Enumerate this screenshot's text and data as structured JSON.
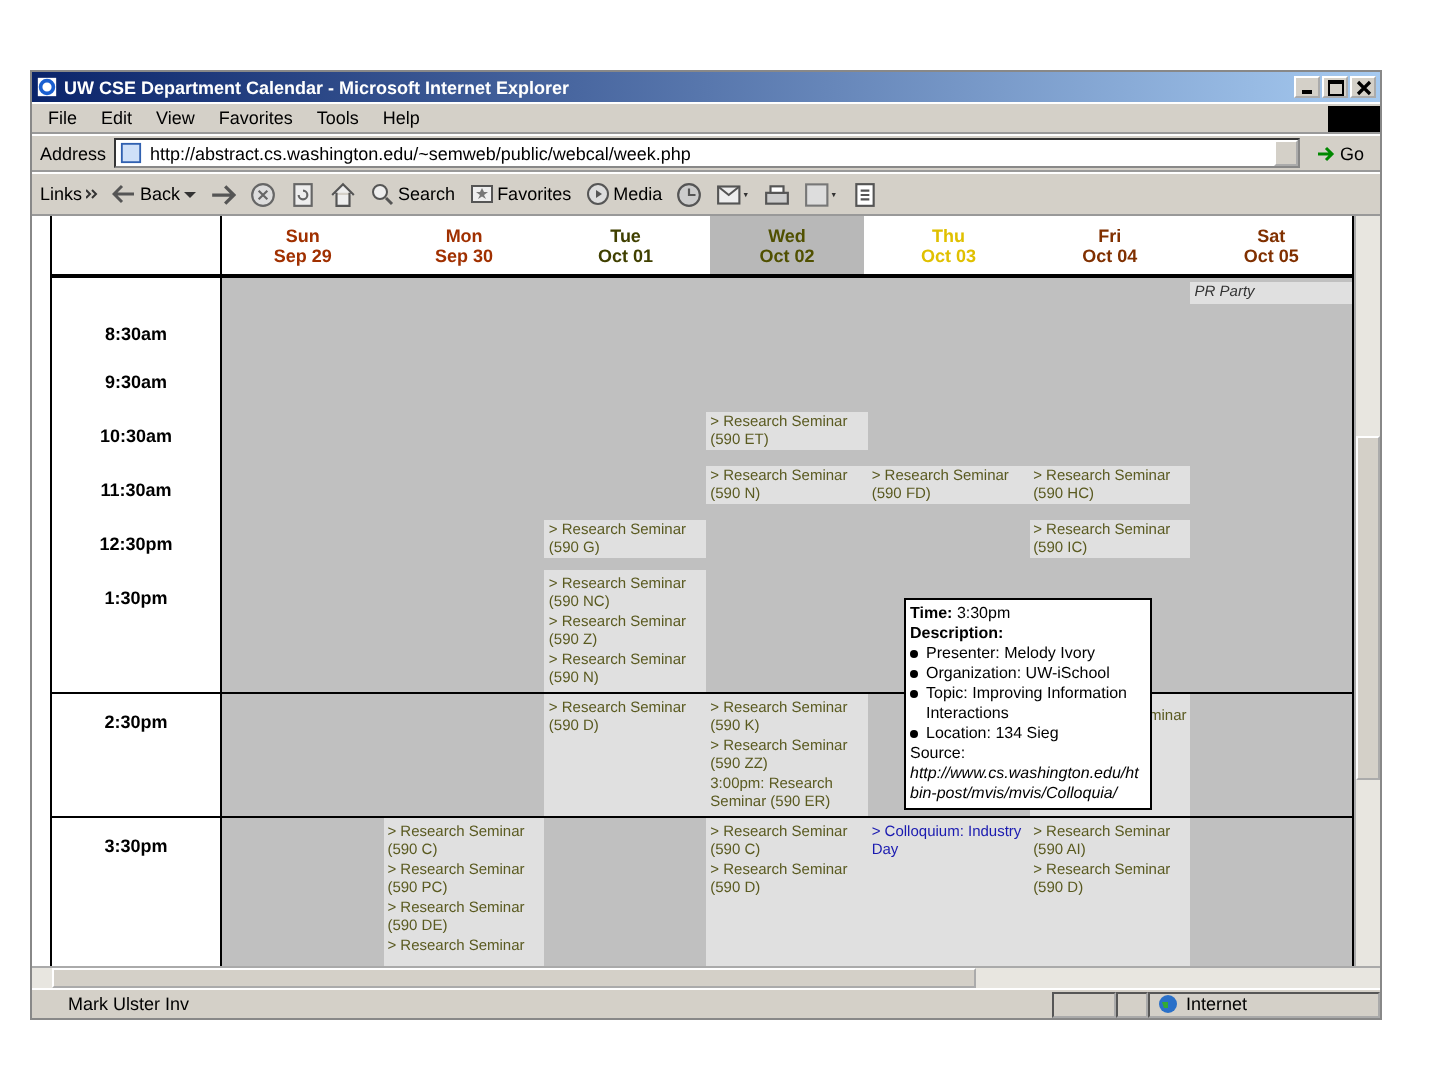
{
  "window": {
    "title": "UW CSE Department Calendar - Microsoft Internet Explorer"
  },
  "menu": [
    "File",
    "Edit",
    "View",
    "Favorites",
    "Tools",
    "Help"
  ],
  "address": {
    "label": "Address",
    "value": "http://abstract.cs.washington.edu/~semweb/public/webcal/week.php",
    "go": "Go"
  },
  "toolbar": {
    "links": "Links",
    "back": "Back",
    "search": "Search",
    "favorites": "Favorites",
    "media": "Media"
  },
  "calendar": {
    "days": [
      {
        "weekday": "Sun",
        "date": "Sep 29",
        "color": "#a03000",
        "selected": false
      },
      {
        "weekday": "Mon",
        "date": "Sep 30",
        "color": "#a03000",
        "selected": false
      },
      {
        "weekday": "Tue",
        "date": "Oct 01",
        "color": "#404000",
        "selected": false
      },
      {
        "weekday": "Wed",
        "date": "Oct 02",
        "color": "#505000",
        "selected": true
      },
      {
        "weekday": "Thu",
        "date": "Oct 03",
        "color": "#e0c000",
        "selected": false
      },
      {
        "weekday": "Fri",
        "date": "Oct 04",
        "color": "#803000",
        "selected": false
      },
      {
        "weekday": "Sat",
        "date": "Oct 05",
        "color": "#803000",
        "selected": false
      }
    ],
    "rows": [
      {
        "time": "8:30am",
        "cells": [
          [],
          [],
          [],
          [],
          [],
          [],
          [
            {
              "kind": "note",
              "text": "PR Party"
            }
          ]
        ]
      },
      {
        "time": "9:30am",
        "cells": [
          [],
          [],
          [],
          [],
          [],
          [],
          []
        ]
      },
      {
        "time": "10:30am",
        "cells": [
          [],
          [],
          [],
          [
            {
              "kind": "seminar",
              "text": "> Research Seminar (590 ET)"
            }
          ],
          [],
          [],
          []
        ]
      },
      {
        "time": "11:30am",
        "cells": [
          [],
          [],
          [],
          [
            {
              "kind": "seminar",
              "text": "> Research Seminar (590 N)"
            }
          ],
          [
            {
              "kind": "seminar",
              "text": "> Research Seminar (590 FD)"
            }
          ],
          [
            {
              "kind": "seminar",
              "text": "> Research Seminar (590 HC)"
            }
          ],
          []
        ]
      },
      {
        "time": "12:30pm",
        "cells": [
          [],
          [],
          [
            {
              "kind": "seminar",
              "text": "> Research Seminar (590 G)"
            }
          ],
          [],
          [],
          [
            {
              "kind": "seminar",
              "text": "> Research Seminar (590 IC)"
            }
          ],
          []
        ]
      },
      {
        "time": "1:30pm",
        "cells": [
          [],
          [],
          [
            {
              "kind": "seminar",
              "text": "> Research Seminar (590 NC)"
            },
            {
              "kind": "seminar",
              "text": "> Research Seminar (590 Z)"
            },
            {
              "kind": "seminar",
              "text": "> Research Seminar (590 N)"
            }
          ],
          [],
          [],
          [],
          []
        ]
      },
      {
        "time": "2:30pm",
        "cells": [
          [],
          [],
          [
            {
              "kind": "seminar",
              "text": "> Research Seminar (590 D)"
            }
          ],
          [
            {
              "kind": "seminar",
              "text": "> Research Seminar (590 K)"
            },
            {
              "kind": "seminar",
              "text": "> Research Seminar (590 ZZ)"
            },
            {
              "kind": "seminar",
              "text": "3:00pm: Research Seminar (590 ER)"
            }
          ],
          [],
          [
            {
              "kind": "fragment",
              "text": "minar"
            }
          ],
          []
        ]
      },
      {
        "time": "3:30pm",
        "cells": [
          [],
          [
            {
              "kind": "seminar",
              "text": "> Research Seminar (590 C)"
            },
            {
              "kind": "seminar",
              "text": "> Research Seminar (590 PC)"
            },
            {
              "kind": "seminar",
              "text": "> Research Seminar (590 DE)"
            },
            {
              "kind": "seminar",
              "text": "> Research Seminar"
            }
          ],
          [],
          [
            {
              "kind": "seminar",
              "text": "> Research Seminar (590 C)"
            },
            {
              "kind": "seminar",
              "text": "> Research Seminar (590 D)"
            }
          ],
          [
            {
              "kind": "colloquium",
              "text": "> Colloquium: Industry Day"
            }
          ],
          [
            {
              "kind": "seminar",
              "text": "> Research Seminar (590 AI)"
            },
            {
              "kind": "seminar",
              "text": "> Research Seminar (590 D)"
            }
          ],
          []
        ]
      }
    ]
  },
  "tooltip": {
    "time_label": "Time:",
    "time": "3:30pm",
    "description_label": "Description:",
    "bullets": [
      "Presenter: Melody Ivory",
      "Organization: UW-iSchool",
      "Topic: Improving Information Interactions",
      "Location: 134 Sieg"
    ],
    "source_label": "Source:",
    "source": "http://www.cs.washington.edu/htbin-post/mvis/mvis/Colloquia/"
  },
  "status_bar": {
    "text": "Mark Ulster Inv",
    "zone": "Internet"
  }
}
